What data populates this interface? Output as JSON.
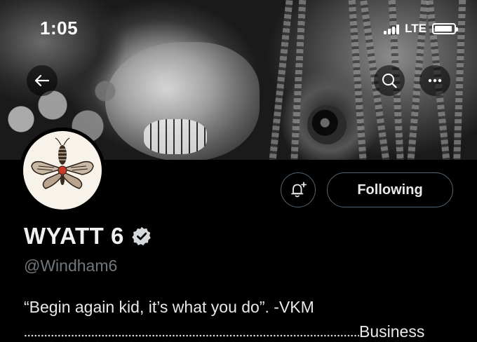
{
  "status_bar": {
    "time": "1:05",
    "network": "LTE"
  },
  "nav": {
    "back_icon": "arrow-left-icon",
    "search_icon": "search-icon",
    "more_icon": "more-horizontal-icon"
  },
  "profile": {
    "display_name": "WYATT 6",
    "verified": true,
    "handle": "@Windham6",
    "bio_line_1": "“Begin again kid, it’s what you do”. -VKM",
    "bio_line_2_suffix": "Business",
    "avatar_icon": "moth-icon"
  },
  "actions": {
    "notify_icon": "bell-plus-icon",
    "following_label": "Following"
  },
  "colors": {
    "background": "#000000",
    "secondary_text": "#71767b",
    "button_border": "#536471"
  }
}
